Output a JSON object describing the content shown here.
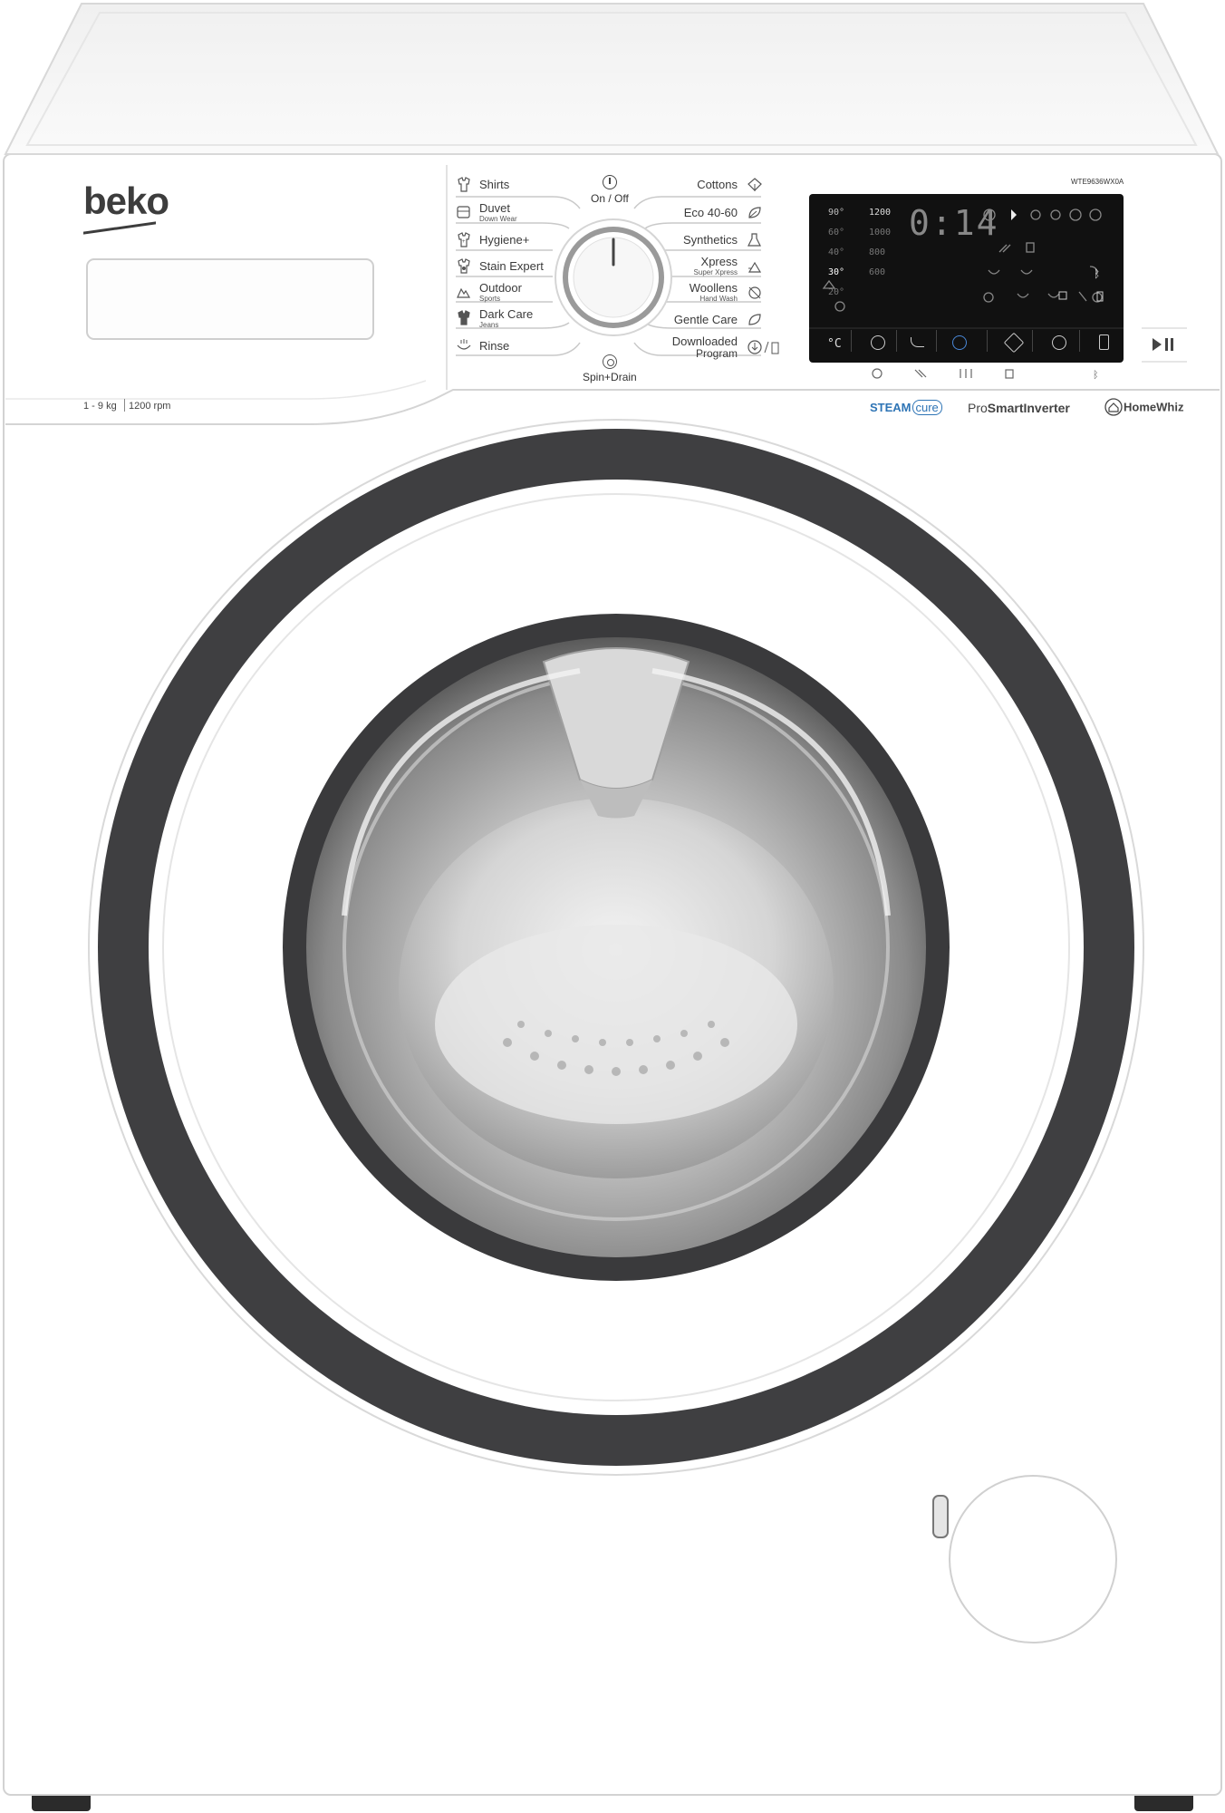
{
  "brand": {
    "logo": "beko",
    "model": "WTE9636WX0A",
    "spec_capacity": "1 - 9 kg",
    "spec_speed": "1200 rpm"
  },
  "dial": {
    "power_label": "On / Off",
    "bottom_label": "Spin+Drain"
  },
  "programs_left": [
    {
      "label": "Shirts",
      "sub": "",
      "icon": "shirt-icon"
    },
    {
      "label": "Duvet",
      "sub": "Down Wear",
      "icon": "duvet-icon"
    },
    {
      "label": "Hygiene+",
      "sub": "",
      "icon": "hygiene-icon"
    },
    {
      "label": "Stain Expert",
      "sub": "",
      "icon": "stain-icon"
    },
    {
      "label": "Outdoor",
      "sub": "Sports",
      "icon": "outdoor-icon"
    },
    {
      "label": "Dark Care",
      "sub": "Jeans",
      "icon": "dark-care-icon"
    },
    {
      "label": "Rinse",
      "sub": "",
      "icon": "rinse-icon"
    }
  ],
  "programs_right": [
    {
      "label": "Cottons",
      "sub": "",
      "icon": "cottons-icon"
    },
    {
      "label": "Eco 40-60",
      "sub": "",
      "icon": "eco-icon"
    },
    {
      "label": "Synthetics",
      "sub": "",
      "icon": "synthetics-icon"
    },
    {
      "label": "Xpress",
      "sub": "Super Xpress",
      "icon": "xpress-icon"
    },
    {
      "label": "Woollens",
      "sub": "Hand Wash",
      "icon": "woollens-icon"
    },
    {
      "label": "Gentle Care",
      "sub": "",
      "icon": "gentle-care-icon"
    },
    {
      "label": "Downloaded",
      "sub": "Program",
      "icon": "download-icon"
    }
  ],
  "display": {
    "time": "0:14",
    "temperatures": [
      "90°",
      "60°",
      "40°",
      "30°",
      "20°"
    ],
    "selected_temperature": "30°",
    "speeds": [
      "1200",
      "1000",
      "800",
      "600"
    ],
    "unit_temp": "°C"
  },
  "features": {
    "steam_a": "STEAM",
    "steam_b": "cure",
    "inverter_a": "Pro",
    "inverter_b": "SmartInverter",
    "homewhiz": "HomeWhiz"
  },
  "colors": {
    "body": "#ffffff",
    "door_ring": "#3f3f41",
    "display": "#111111",
    "steam_blue": "#2e74b5",
    "accent_blue": "#4a88d8"
  }
}
